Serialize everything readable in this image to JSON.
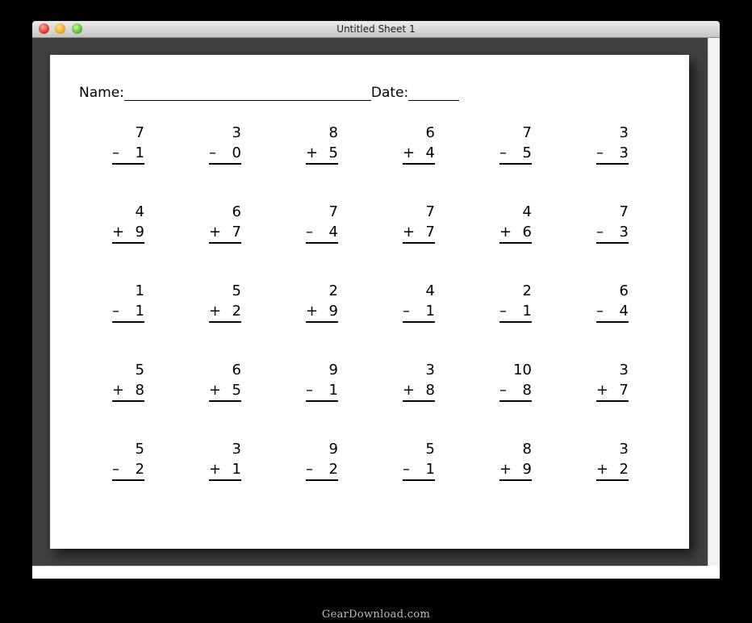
{
  "window": {
    "title": "Untitled Sheet 1"
  },
  "worksheet": {
    "name_label": "Name:",
    "date_label": "Date:",
    "rows": [
      [
        {
          "top": "7",
          "op": "–",
          "bottom": "1"
        },
        {
          "top": "3",
          "op": "–",
          "bottom": "0"
        },
        {
          "top": "8",
          "op": "+",
          "bottom": "5"
        },
        {
          "top": "6",
          "op": "+",
          "bottom": "4"
        },
        {
          "top": "7",
          "op": "–",
          "bottom": "5"
        },
        {
          "top": "3",
          "op": "–",
          "bottom": "3"
        }
      ],
      [
        {
          "top": "4",
          "op": "+",
          "bottom": "9"
        },
        {
          "top": "6",
          "op": "+",
          "bottom": "7"
        },
        {
          "top": "7",
          "op": "–",
          "bottom": "4"
        },
        {
          "top": "7",
          "op": "+",
          "bottom": "7"
        },
        {
          "top": "4",
          "op": "+",
          "bottom": "6"
        },
        {
          "top": "7",
          "op": "–",
          "bottom": "3"
        }
      ],
      [
        {
          "top": "1",
          "op": "–",
          "bottom": "1"
        },
        {
          "top": "5",
          "op": "+",
          "bottom": "2"
        },
        {
          "top": "2",
          "op": "+",
          "bottom": "9"
        },
        {
          "top": "4",
          "op": "–",
          "bottom": "1"
        },
        {
          "top": "2",
          "op": "–",
          "bottom": "1"
        },
        {
          "top": "6",
          "op": "–",
          "bottom": "4"
        }
      ],
      [
        {
          "top": "5",
          "op": "+",
          "bottom": "8"
        },
        {
          "top": "6",
          "op": "+",
          "bottom": "5"
        },
        {
          "top": "9",
          "op": "–",
          "bottom": "1"
        },
        {
          "top": "3",
          "op": "+",
          "bottom": "8"
        },
        {
          "top": "10",
          "op": "–",
          "bottom": "8"
        },
        {
          "top": "3",
          "op": "+",
          "bottom": "7"
        }
      ],
      [
        {
          "top": "5",
          "op": "–",
          "bottom": "2"
        },
        {
          "top": "3",
          "op": "+",
          "bottom": "1"
        },
        {
          "top": "9",
          "op": "–",
          "bottom": "2"
        },
        {
          "top": "5",
          "op": "–",
          "bottom": "1"
        },
        {
          "top": "8",
          "op": "+",
          "bottom": "9"
        },
        {
          "top": "3",
          "op": "+",
          "bottom": "2"
        }
      ]
    ]
  },
  "footer": {
    "watermark": "GearDownload.com"
  }
}
